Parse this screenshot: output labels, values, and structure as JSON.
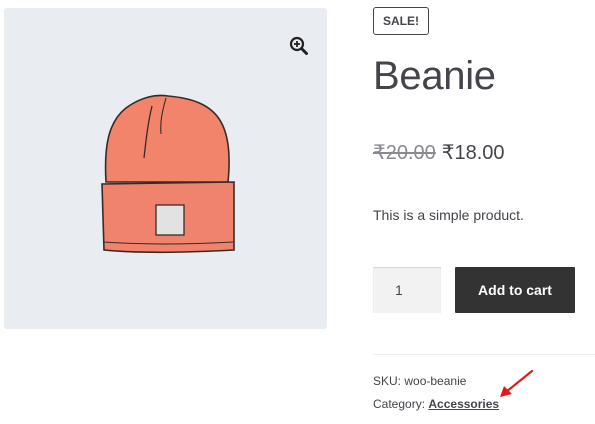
{
  "product": {
    "sale_badge": "SALE!",
    "title": "Beanie",
    "price_regular": "₹20.00",
    "price_sale": "₹18.00",
    "description": "This is a simple product.",
    "quantity": "1",
    "add_to_cart_label": "Add to cart",
    "sku_label": "SKU:",
    "sku_value": "woo-beanie",
    "category_label": "Category:",
    "category_link": "Accessories"
  },
  "gallery": {
    "image_icon": "beanie-illustration",
    "zoom_icon": "magnifier-plus-icon",
    "background": "#e9edf1"
  },
  "annotation": {
    "arrow_color": "#e11b1b"
  },
  "colors": {
    "button_bg": "#333333",
    "text": "#43454b",
    "muted": "#888a8f"
  }
}
